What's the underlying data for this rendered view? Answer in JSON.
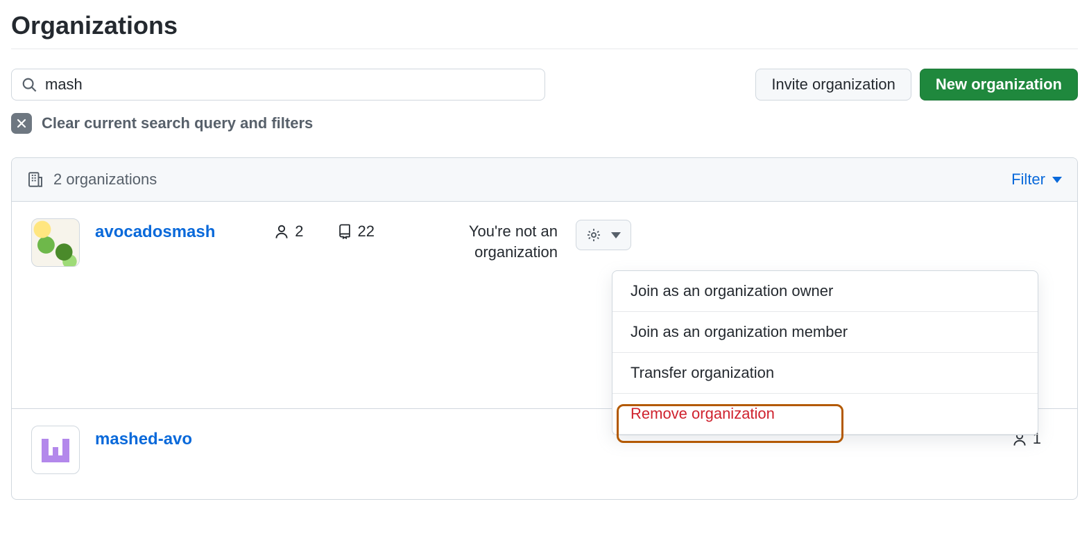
{
  "page": {
    "title": "Organizations"
  },
  "search": {
    "value": "mash"
  },
  "buttons": {
    "invite": "Invite organization",
    "new_org": "New organization"
  },
  "clear": {
    "label": "Clear current search query and filters"
  },
  "list_header": {
    "count_label": "2 organizations",
    "filter_label": "Filter"
  },
  "orgs": [
    {
      "name": "avocadosmash",
      "members": "2",
      "repos": "22",
      "role_line": "You're not an organization"
    },
    {
      "name": "mashed-avo",
      "members": "1"
    }
  ],
  "dropdown": {
    "join_owner": "Join as an organization owner",
    "join_member": "Join as an organization member",
    "transfer": "Transfer organization",
    "remove": "Remove organization"
  }
}
